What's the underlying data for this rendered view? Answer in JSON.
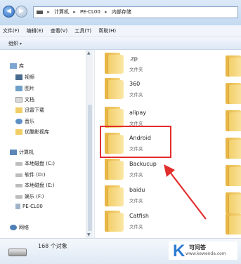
{
  "address": {
    "segments": [
      "计算机",
      "PE-CL00",
      "内部存储"
    ]
  },
  "menu": [
    "文件(F)",
    "编辑(E)",
    "查看(V)",
    "工具(T)",
    "帮助(H)"
  ],
  "toolbar": {
    "organize": "组织"
  },
  "nav": {
    "library_header": "库",
    "library_items": [
      "视频",
      "图片",
      "文档",
      "迅雷下载",
      "音乐",
      "优酷影视库"
    ],
    "computer_header": "计算机",
    "drives": [
      "本地磁盘 (C:)",
      "软件 (D:)",
      "本地磁盘 (E:)",
      "娱乐 (F:)",
      "PE-CL00"
    ],
    "network": "网络"
  },
  "folders": [
    {
      "name": ".zp",
      "type": "文件夹"
    },
    {
      "name": "360",
      "type": "文件夹"
    },
    {
      "name": "alipay",
      "type": "文件夹"
    },
    {
      "name": "Android",
      "type": "文件夹"
    },
    {
      "name": "Backucup",
      "type": "文件夹"
    },
    {
      "name": "baidu",
      "type": "文件夹"
    },
    {
      "name": "Catfish",
      "type": "文件夹"
    }
  ],
  "status": {
    "count": "168 个对象"
  },
  "watermark": {
    "title": "可问答",
    "url": "www.kewenda.com"
  },
  "colors": {
    "annotation": "#e22d2d",
    "address_bar": "#c4d9f0",
    "folder": "#f3cf6a"
  }
}
